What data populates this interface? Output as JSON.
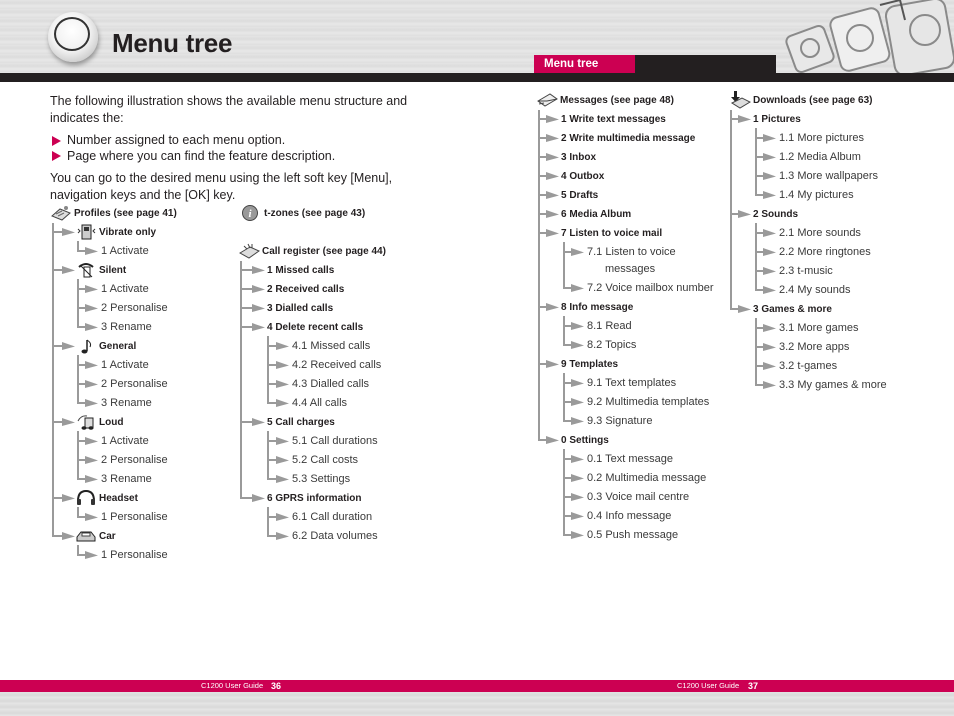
{
  "header": {
    "title": "Menu tree",
    "tab_label": "Menu tree"
  },
  "intro": {
    "paragraph1": "The following illustration shows the available menu structure and indicates the:",
    "bullets": [
      "Number assigned to each menu option.",
      "Page where you can find the feature description."
    ],
    "paragraph2": "You can go to the desired menu using the left soft key [Menu], navigation keys and the [OK] key."
  },
  "trees": {
    "profiles": {
      "label": "Profiles (see page 41)",
      "icon": "profiles-icon",
      "groups": [
        {
          "label": "Vibrate only",
          "icon": "vibrate-icon",
          "items": [
            "1 Activate"
          ]
        },
        {
          "label": "Silent",
          "icon": "silent-icon",
          "items": [
            "1 Activate",
            "2 Personalise",
            "3 Rename"
          ]
        },
        {
          "label": "General",
          "icon": "music-note-icon",
          "items": [
            "1 Activate",
            "2 Personalise",
            "3 Rename"
          ]
        },
        {
          "label": "Loud",
          "icon": "loud-icon",
          "items": [
            "1 Activate",
            "2 Personalise",
            "3 Rename"
          ]
        },
        {
          "label": "Headset",
          "icon": "headset-icon",
          "items": [
            "1 Personalise"
          ]
        },
        {
          "label": "Car",
          "icon": "car-icon",
          "items": [
            "1 Personalise"
          ]
        }
      ]
    },
    "tzones": {
      "label": "t-zones (see page 43)",
      "icon": "info-icon"
    },
    "call_register": {
      "label": "Call register (see page 44)",
      "icon": "call-register-icon",
      "groups": [
        {
          "label": "1 Missed calls",
          "items": []
        },
        {
          "label": "2 Received calls",
          "items": []
        },
        {
          "label": "3 Dialled calls",
          "items": []
        },
        {
          "label": "4 Delete recent calls",
          "items": [
            "4.1 Missed calls",
            "4.2 Received calls",
            "4.3 Dialled calls",
            "4.4 All calls"
          ]
        },
        {
          "label": "5 Call charges",
          "items": [
            "5.1 Call durations",
            "5.2 Call costs",
            "5.3 Settings"
          ]
        },
        {
          "label": "6 GPRS information",
          "items": [
            "6.1 Call duration",
            "6.2 Data volumes"
          ]
        }
      ]
    },
    "messages": {
      "label": "Messages (see page 48)",
      "icon": "messages-icon",
      "groups": [
        {
          "label": "1 Write text messages",
          "items": []
        },
        {
          "label": "2 Write multimedia message",
          "items": []
        },
        {
          "label": "3 Inbox",
          "items": []
        },
        {
          "label": "4 Outbox",
          "items": []
        },
        {
          "label": "5 Drafts",
          "items": []
        },
        {
          "label": "6 Media Album",
          "items": []
        },
        {
          "label": "7 Listen to voice mail",
          "items": [
            "7.1 Listen to voice messages",
            "7.2 Voice mailbox number"
          ]
        },
        {
          "label": "8 Info message",
          "items": [
            "8.1 Read",
            "8.2 Topics"
          ]
        },
        {
          "label": "9 Templates",
          "items": [
            "9.1 Text templates",
            "9.2 Multimedia templates",
            "9.3 Signature"
          ]
        },
        {
          "label": "0 Settings",
          "items": [
            "0.1 Text message",
            "0.2 Multimedia message",
            "0.3 Voice mail centre",
            "0.4 Info message",
            "0.5 Push message"
          ]
        }
      ]
    },
    "downloads": {
      "label": "Downloads (see page 63)",
      "icon": "downloads-icon",
      "groups": [
        {
          "label": "1 Pictures",
          "items": [
            "1.1 More pictures",
            "1.2 Media Album",
            "1.3 More wallpapers",
            "1.4 My pictures"
          ]
        },
        {
          "label": "2 Sounds",
          "items": [
            "2.1 More sounds",
            "2.2 More ringtones",
            "2.3 t-music",
            "2.4 My sounds"
          ]
        },
        {
          "label": "3 Games & more",
          "items": [
            "3.1 More games",
            "3.2 More apps",
            "3.2 t-games",
            "3.3 My games & more"
          ]
        }
      ]
    }
  },
  "footer": {
    "left_text": "C1200 User Guide",
    "left_page": "36",
    "right_text": "C1200 User Guide",
    "right_page": "37"
  },
  "colors": {
    "accent": "#cc0052",
    "dark_bar": "#231f20",
    "tree_line": "#9a9a9a"
  }
}
